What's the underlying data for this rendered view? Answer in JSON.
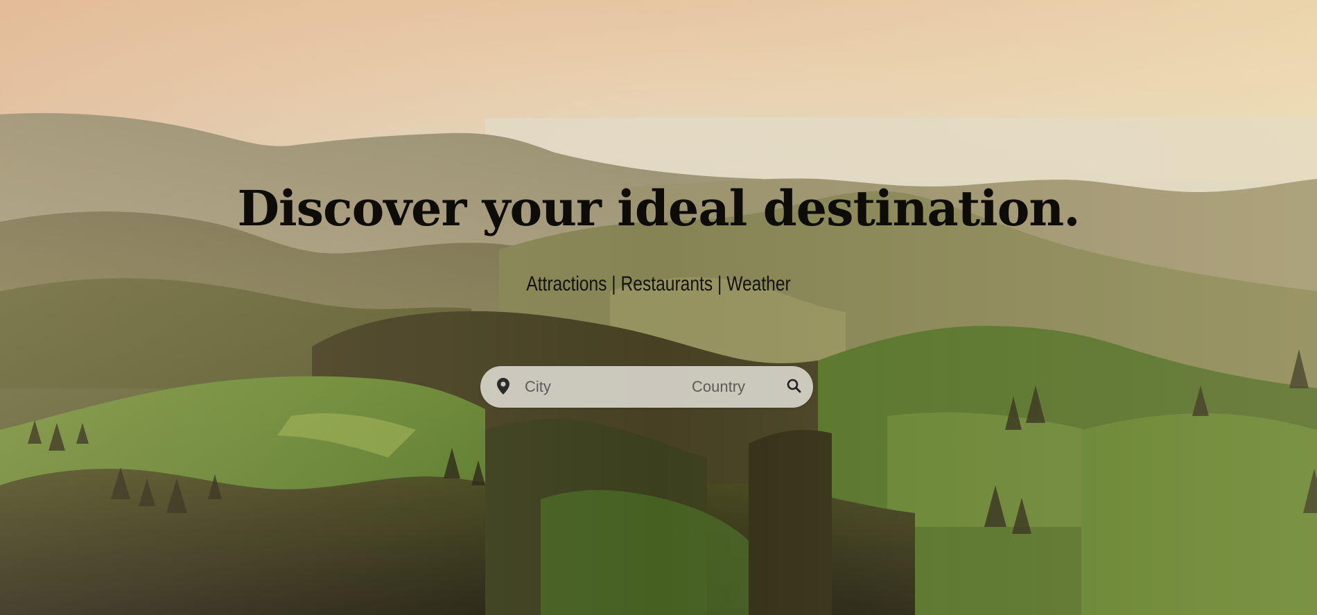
{
  "hero": {
    "title": "Discover your ideal destination.",
    "subtitle": "Attractions | Restaurants | Weather",
    "title_color": "#0d0c08"
  },
  "search": {
    "city_placeholder": "City",
    "country_placeholder": "Country",
    "location_icon": "map-pin-icon",
    "search_icon": "magnifier-icon"
  }
}
